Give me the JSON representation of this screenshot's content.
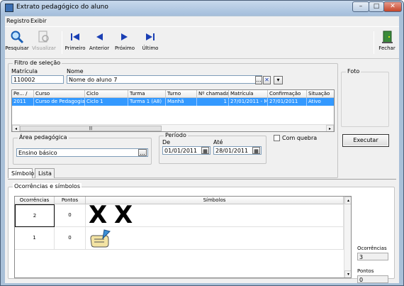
{
  "window": {
    "title": "Extrato pedagógico do aluno",
    "min": "–",
    "max": "□",
    "close": "✕"
  },
  "menu": [
    "Registro",
    "Exibir"
  ],
  "toolbar": {
    "pesquisar": "Pesquisar",
    "visualizar": "Visualizar",
    "primeiro": "Primeiro",
    "anterior": "Anterior",
    "proximo": "Próximo",
    "ultimo": "Último",
    "fechar": "Fechar"
  },
  "filtro": {
    "legend": "Filtro de seleção",
    "matricula_label": "Matrícula",
    "matricula_value": "110002",
    "nome_label": "Nome",
    "nome_value": "Nome do aluno 7",
    "btn_dots": "...",
    "btn_x": "✕",
    "btn_dd": "▾"
  },
  "grid": {
    "headers": [
      "Pe... /",
      "Curso",
      "Ciclo",
      "Turma",
      "Turno",
      "Nº chamada",
      "Matrícula",
      "Confirmação",
      "Situação"
    ],
    "rows": [
      [
        "2011",
        "Curso de Pedagogia",
        "Ciclo 1",
        "Turma 1   (A8)",
        "Manhã",
        "1",
        "27/01/2011 - M",
        "27/01/2011",
        "Ativo"
      ]
    ],
    "scroll_left": "◂",
    "scroll_right": "▸",
    "scroll_grip": "|||"
  },
  "foto": {
    "label": "Foto"
  },
  "area": {
    "legend": "Área pedagógica",
    "value": "Ensino básico",
    "btn": "..."
  },
  "periodo": {
    "legend": "Período",
    "de_label": "De",
    "de_value": "01/01/2011",
    "ate_label": "Até",
    "ate_value": "28/01/2011",
    "cal": "▦"
  },
  "com_quebra": {
    "label": "Com quebra",
    "checked": false
  },
  "executar": "Executar",
  "tabs": [
    "Símbolo",
    "Lista"
  ],
  "ocorrencias_group": {
    "legend": "Ocorrências e símbolos",
    "headers": [
      "Ocorrências",
      "Pontos",
      "Símbolos"
    ],
    "rows": [
      {
        "ocorrencias": "2",
        "pontos": "0",
        "simbolos": [
          "X",
          "X"
        ]
      },
      {
        "ocorrencias": "1",
        "pontos": "0",
        "simbolos": [
          "scroll-quill-icon"
        ]
      }
    ],
    "scroll_up": "▴",
    "scroll_down": "▾"
  },
  "summary": {
    "ocorrencias_label": "Ocorrências",
    "ocorrencias_value": "3",
    "pontos_label": "Pontos",
    "pontos_value": "0"
  }
}
